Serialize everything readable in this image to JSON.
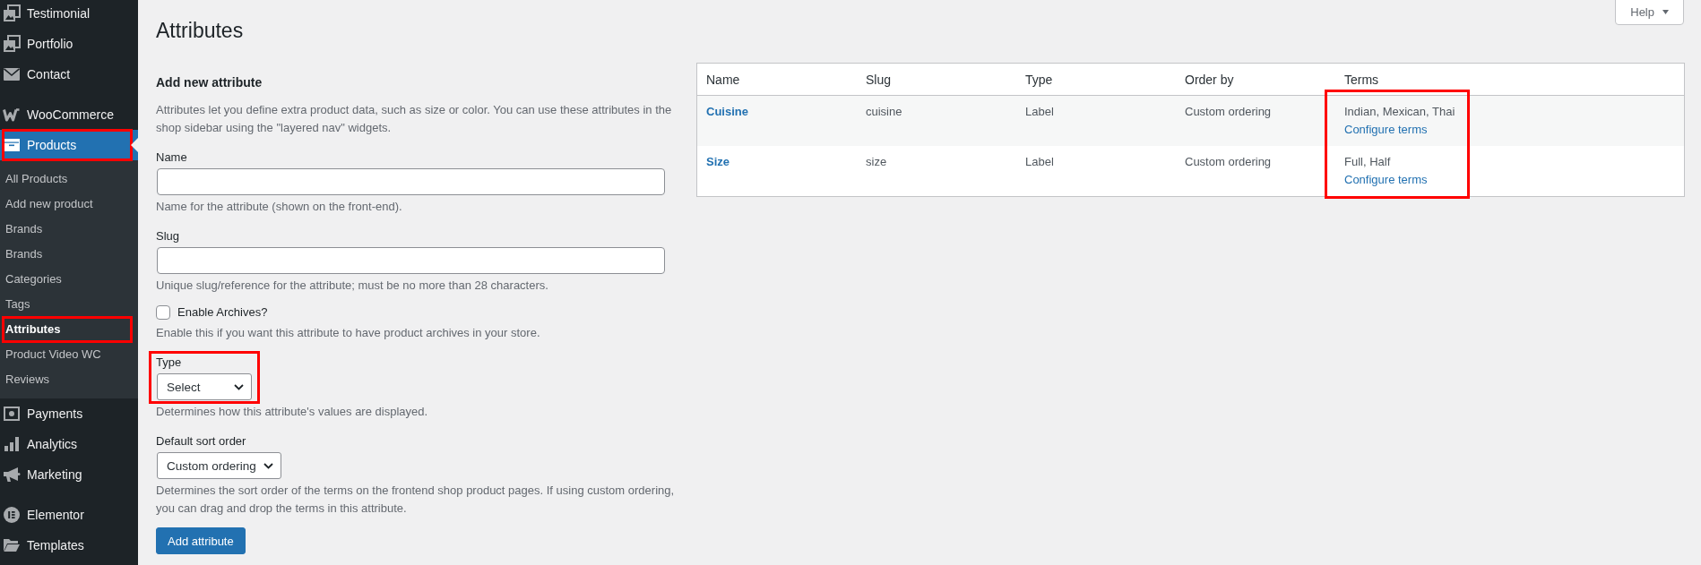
{
  "sidebar": {
    "groups": [
      {
        "items": [
          {
            "label": "Testimonial",
            "selected": false,
            "highlighted": false
          },
          {
            "label": "Portfolio",
            "selected": false,
            "highlighted": false
          },
          {
            "label": "Contact",
            "selected": false,
            "highlighted": false
          }
        ]
      },
      {
        "items": [
          {
            "label": "WooCommerce",
            "selected": false,
            "highlighted": false
          },
          {
            "label": "Products",
            "selected": true,
            "highlighted": true,
            "children": [
              {
                "label": "All Products",
                "selected": false,
                "highlighted": false
              },
              {
                "label": "Add new product",
                "selected": false,
                "highlighted": false
              },
              {
                "label": "Brands",
                "selected": false,
                "highlighted": false
              },
              {
                "label": "Brands",
                "selected": false,
                "highlighted": false
              },
              {
                "label": "Categories",
                "selected": false,
                "highlighted": false
              },
              {
                "label": "Tags",
                "selected": false,
                "highlighted": false
              },
              {
                "label": "Attributes",
                "selected": true,
                "highlighted": true
              },
              {
                "label": "Product Video WC",
                "selected": false,
                "highlighted": false
              },
              {
                "label": "Reviews",
                "selected": false,
                "highlighted": false
              }
            ]
          },
          {
            "label": "Payments",
            "selected": false,
            "highlighted": false
          },
          {
            "label": "Analytics",
            "selected": false,
            "highlighted": false
          },
          {
            "label": "Marketing",
            "selected": false,
            "highlighted": false
          }
        ]
      },
      {
        "items": [
          {
            "label": "Elementor",
            "selected": false,
            "highlighted": false
          },
          {
            "label": "Templates",
            "selected": false,
            "highlighted": false
          }
        ]
      }
    ]
  },
  "header": {
    "title": "Attributes",
    "help_button": "Help"
  },
  "form": {
    "heading": "Add new attribute",
    "description": "Attributes let you define extra product data, such as size or color. You can use these attributes in the shop sidebar using the \"layered nav\" widgets.",
    "fields": [
      {
        "kind": "text",
        "label": "Name",
        "hint": "Name for the attribute (shown on the front-end).",
        "highlighted": false
      },
      {
        "kind": "text",
        "label": "Slug",
        "hint": "Unique slug/reference for the attribute; must be no more than 28 characters.",
        "highlighted": false
      },
      {
        "kind": "checkbox",
        "label": "Enable Archives?",
        "checked": false,
        "hint": "Enable this if you want this attribute to have product archives in your store.",
        "highlighted": false
      },
      {
        "kind": "select",
        "label": "Type",
        "value": "Select",
        "hint": "Determines how this attribute's values are displayed.",
        "highlighted": true
      },
      {
        "kind": "select",
        "label": "Default sort order",
        "value": "Custom ordering",
        "hint": "Determines the sort order of the terms on the frontend shop product pages. If using custom ordering, you can drag and drop the terms in this attribute.",
        "highlighted": false
      }
    ],
    "submit_button": "Add attribute"
  },
  "table": {
    "columns": [
      {
        "label": "Name",
        "highlighted": false
      },
      {
        "label": "Slug",
        "highlighted": false
      },
      {
        "label": "Type",
        "highlighted": false
      },
      {
        "label": "Order by",
        "highlighted": false
      },
      {
        "label": "Terms",
        "highlighted": true
      }
    ],
    "rows": [
      {
        "name": "Cuisine",
        "slug": "cuisine",
        "type": "Label",
        "order_by": "Custom ordering",
        "terms": "Indian, Mexican, Thai",
        "terms_link": "Configure terms"
      },
      {
        "name": "Size",
        "slug": "size",
        "type": "Label",
        "order_by": "Custom ordering",
        "terms": "Full, Half",
        "terms_link": "Configure terms"
      }
    ]
  }
}
